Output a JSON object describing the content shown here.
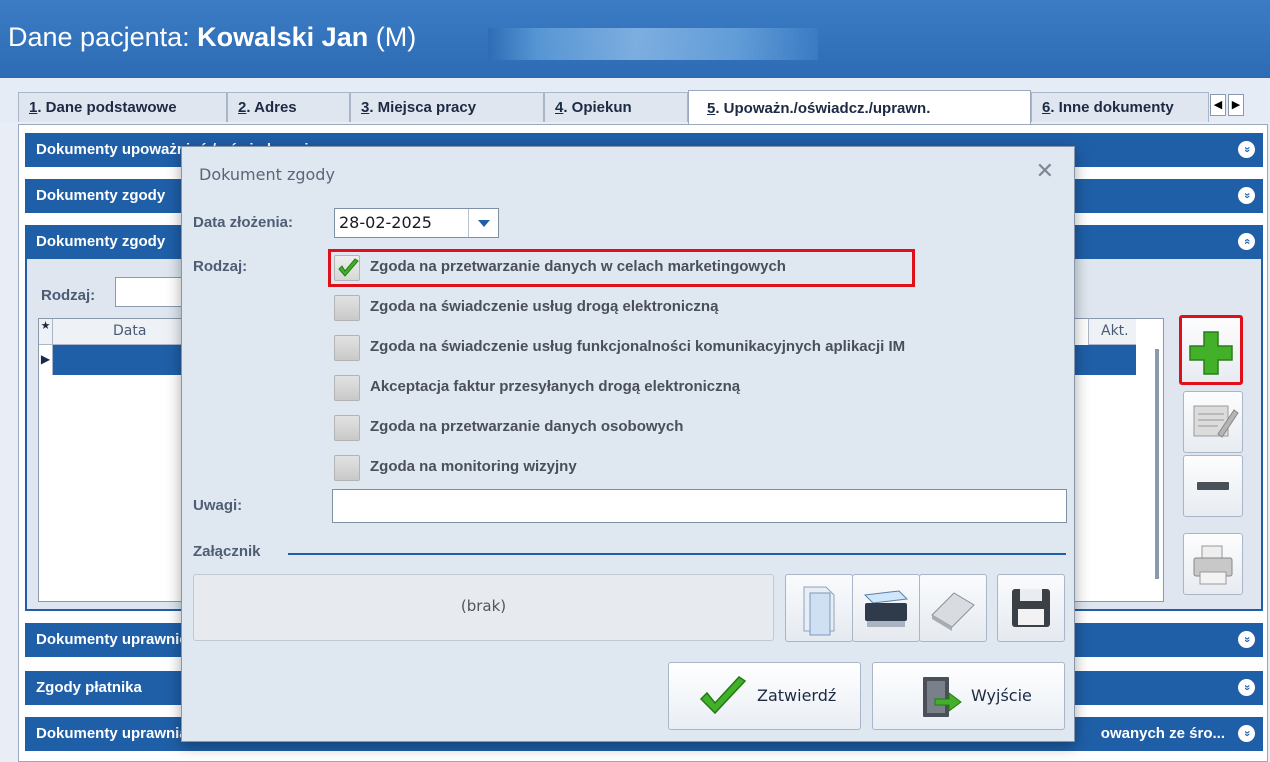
{
  "window": {
    "title_prefix": "Dane pacjenta: ",
    "patient_name": "Kowalski Jan",
    "patient_sex": " (M)"
  },
  "tabs": [
    {
      "num": "1",
      "label": ". Dane podstawowe"
    },
    {
      "num": "2",
      "label": ". Adres"
    },
    {
      "num": "3",
      "label": ". Miejsca pracy"
    },
    {
      "num": "4",
      "label": ". Opiekun"
    },
    {
      "num": "5",
      "label": ". Upoważn./oświadcz./uprawn."
    },
    {
      "num": "6",
      "label": ". Inne dokumenty"
    }
  ],
  "tab_scroll": {
    "left": "◀",
    "right": "▶"
  },
  "sections": {
    "s1": "Dokumenty upoważnień / oświadczenia",
    "s2": "Dokumenty zgody",
    "s3": "Dokumenty zgody",
    "s4": "Dokumenty uprawnień",
    "s5": "Zgody płatnika",
    "s6": "Dokumenty uprawniających do świadczeń finansowanych ze środków publicznych",
    "s6_tail": "owanych ze śro..."
  },
  "section_chevron_down": "»",
  "section_chevron_up": "«",
  "filter": {
    "rodzaj_label": "Rodzaj:"
  },
  "grid": {
    "star": "★",
    "col_data": "Data",
    "col_akt": "Akt.",
    "row_indicator": "▶"
  },
  "dialog": {
    "title": "Dokument zgody",
    "close": "✕",
    "date_label": "Data złożenia:",
    "date_value": "28-02-2025",
    "rodzaj_label": "Rodzaj:",
    "checkboxes": [
      {
        "label": "Zgoda na przetwarzanie danych w celach marketingowych",
        "checked": true
      },
      {
        "label": "Zgoda na świadczenie usług drogą elektroniczną",
        "checked": false
      },
      {
        "label": "Zgoda na świadczenie usług funkcjonalności komunikacyjnych aplikacji IM",
        "checked": false
      },
      {
        "label": "Akceptacja faktur przesyłanych drogą elektroniczną",
        "checked": false
      },
      {
        "label": "Zgoda na przetwarzanie danych osobowych",
        "checked": false
      },
      {
        "label": "Zgoda na monitoring wizyjny",
        "checked": false
      }
    ],
    "uwagi_label": "Uwagi:",
    "uwagi_value": "",
    "zalacznik_label": "Załącznik",
    "attachment_placeholder": "(brak)",
    "confirm_label": "Zatwierdź",
    "exit_label": "Wyjście"
  },
  "colors": {
    "header_blue": "#2d6cb4",
    "section_blue": "#1f5fa8",
    "highlight_red": "#e0101a",
    "check_green": "#3ea62c"
  },
  "icons": {
    "add": "plus-icon",
    "edit": "edit-document-icon",
    "remove": "minus-icon",
    "print": "printer-icon",
    "file": "file-open-icon",
    "scan": "scanner-icon",
    "erase": "eraser-icon",
    "save": "floppy-disk-icon",
    "confirm": "checkmark-icon",
    "exit": "exit-door-icon"
  }
}
